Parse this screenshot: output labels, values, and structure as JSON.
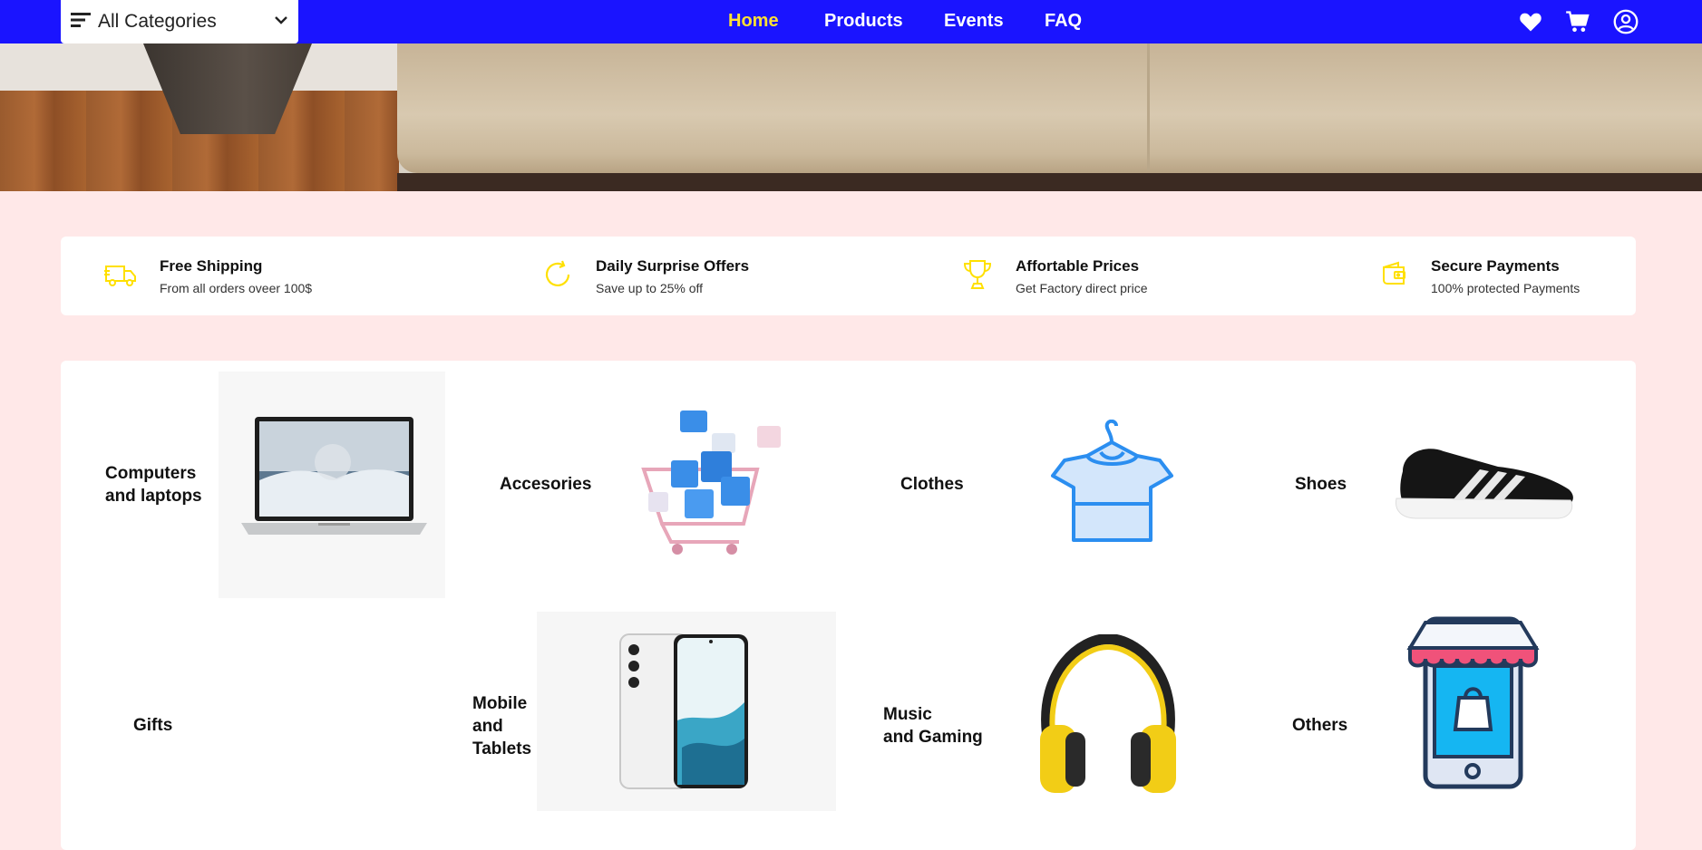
{
  "nav": {
    "category_select": {
      "label": "All Categories",
      "icon": "menu-icon"
    },
    "links": [
      {
        "label": "Home",
        "active": true
      },
      {
        "label": "Products",
        "active": false
      },
      {
        "label": "Events",
        "active": false
      },
      {
        "label": "FAQ",
        "active": false
      }
    ],
    "icons": [
      "heart-icon",
      "cart-icon",
      "user-icon"
    ]
  },
  "features": [
    {
      "title": "Free Shipping",
      "subtitle": "From all orders oveer 100$",
      "icon": "truck-icon"
    },
    {
      "title": "Daily Surprise Offers",
      "subtitle": "Save up to 25% off",
      "icon": "refresh-icon"
    },
    {
      "title": "Affortable Prices",
      "subtitle": "Get Factory direct price",
      "icon": "trophy-icon"
    },
    {
      "title": "Secure Payments",
      "subtitle": "100% protected Payments",
      "icon": "wallet-icon"
    }
  ],
  "categories": [
    {
      "name": "Computers\nand laptops",
      "image": "laptop-image"
    },
    {
      "name": "Accesories",
      "image": "shopping-cart-gifts-image"
    },
    {
      "name": "Clothes",
      "image": "tshirt-hanger-image"
    },
    {
      "name": "Shoes",
      "image": "sneaker-image"
    },
    {
      "name": "Gifts",
      "image": ""
    },
    {
      "name": "Mobile\nand\nTablets",
      "image": "smartphone-image"
    },
    {
      "name": "Music\nand Gaming",
      "image": "headphones-image"
    },
    {
      "name": "Others",
      "image": "shop-phone-image"
    }
  ],
  "colors": {
    "nav_bg": "#1a14ff",
    "nav_active": "#ffe033",
    "page_bg": "#ffe8e8",
    "feature_icon": "#ffe000",
    "clothes_icon": "#2b8ef0"
  }
}
